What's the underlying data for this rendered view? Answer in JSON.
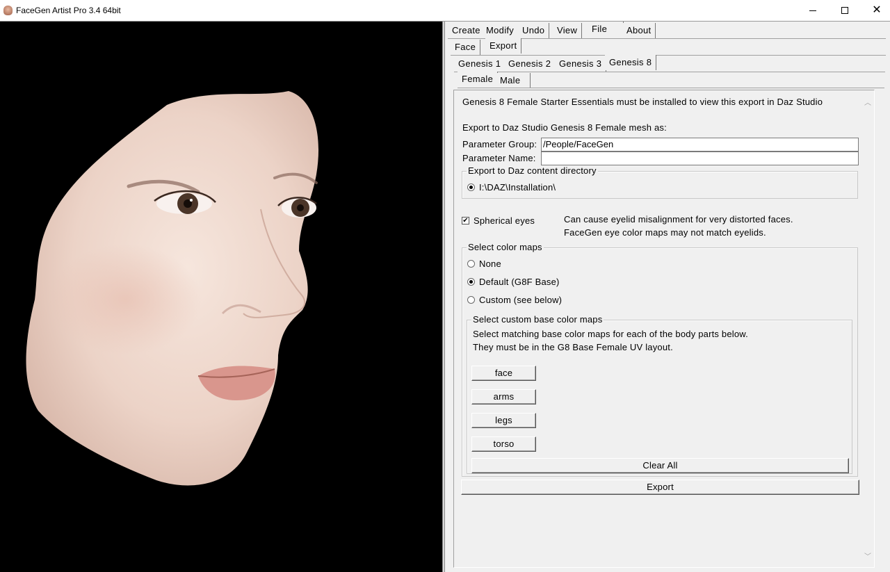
{
  "window": {
    "title": "FaceGen Artist Pro 3.4 64bit",
    "minimize": "—",
    "maximize": "☐",
    "close": "✕"
  },
  "menu_tabs": [
    "Create",
    "Modify",
    "Undo",
    "View",
    "File",
    "About"
  ],
  "menu_active": "File",
  "sub_tabs": [
    "Face",
    "Export"
  ],
  "sub_active": "Export",
  "genesis_tabs": [
    "Genesis 1",
    "Genesis 2",
    "Genesis 3",
    "Genesis 8"
  ],
  "genesis_active": "Genesis 8",
  "gender_tabs": [
    "Female",
    "Male"
  ],
  "gender_active": "Female",
  "export": {
    "notice": "Genesis 8 Female Starter Essentials must be installed to view this export in Daz Studio",
    "mesh_label": "Export to Daz Studio Genesis 8 Female mesh as:",
    "param_group_label": "Parameter Group:",
    "param_group_value": "/People/FaceGen",
    "param_name_label": "Parameter Name:",
    "param_name_value": "",
    "content_dir_title": "Export to Daz content directory",
    "content_dir_option": "I:\\DAZ\\Installation\\",
    "spherical_eyes_label": "Spherical eyes",
    "spherical_eyes_checked": true,
    "spherical_note_1": "Can cause eyelid misalignment for very distorted faces.",
    "spherical_note_2": "FaceGen eye color maps may not match eyelids.",
    "color_maps_title": "Select color maps",
    "color_map_options": [
      "None",
      "Default (G8F Base)",
      "Custom (see below)"
    ],
    "color_map_selected": "Default (G8F Base)",
    "custom_title": "Select custom base color maps",
    "custom_desc_1": "Select matching base color maps for each of the body parts below.",
    "custom_desc_2": "They must be in the G8 Base Female UV layout.",
    "body_part_buttons": [
      "face",
      "arms",
      "legs",
      "torso"
    ],
    "clear_all": "Clear All",
    "export_button": "Export"
  }
}
